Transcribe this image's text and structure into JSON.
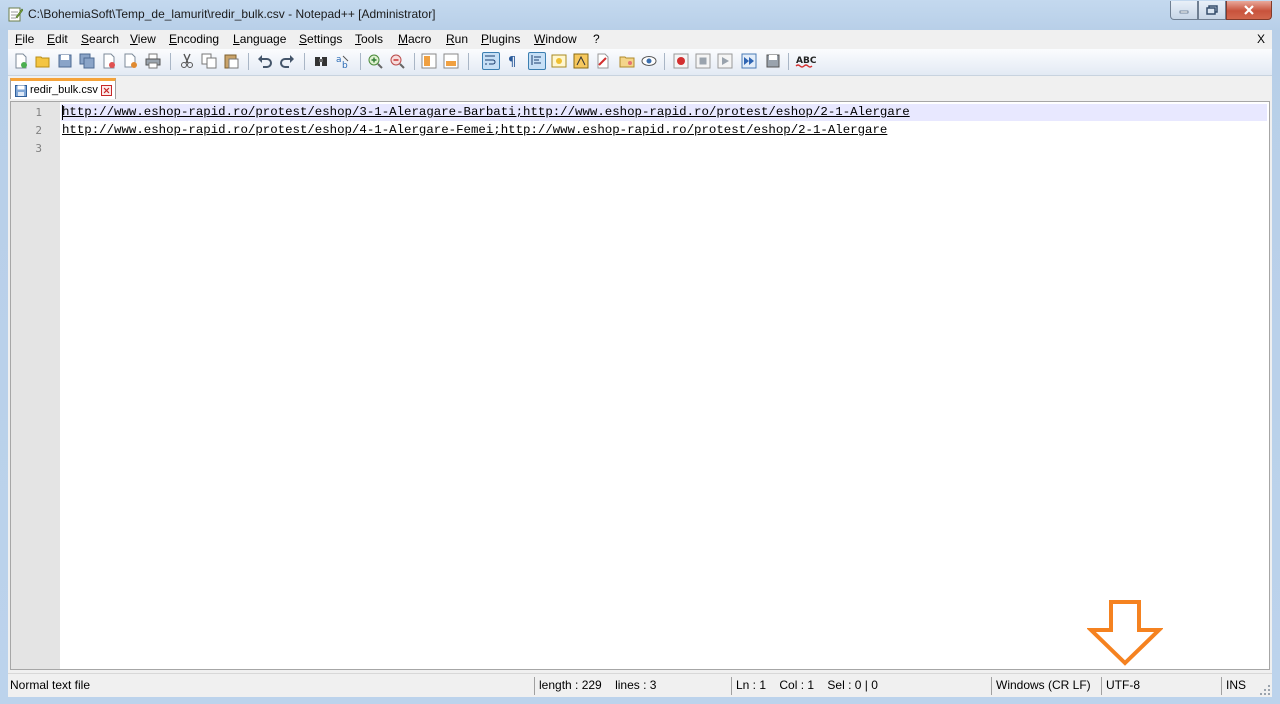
{
  "window": {
    "title": "C:\\BohemiaSoft\\Temp_de_lamurit\\redir_bulk.csv - Notepad++ [Administrator]"
  },
  "menu": {
    "items": [
      "File",
      "Edit",
      "Search",
      "View",
      "Encoding",
      "Language",
      "Settings",
      "Tools",
      "Macro",
      "Run",
      "Plugins",
      "Window",
      "?"
    ],
    "close_label": "X"
  },
  "toolbar": {
    "buttons": [
      "new-file-icon",
      "open-file-icon",
      "save-icon",
      "save-all-icon",
      "close-icon",
      "close-all-icon",
      "print-icon",
      "cut-icon",
      "copy-icon",
      "paste-icon",
      "undo-icon",
      "redo-icon",
      "find-icon",
      "replace-icon",
      "zoom-in-icon",
      "zoom-out-icon",
      "sync-vertical-icon",
      "sync-horizontal-icon",
      "word-wrap-icon",
      "show-all-chars-icon",
      "indent-guide-icon",
      "user-defined-language-icon",
      "function-list-icon",
      "doc-map-icon",
      "folder-workspace-icon",
      "monitor-icon",
      "record-macro-icon",
      "stop-macro-icon",
      "play-macro-icon",
      "run-macro-multiple-icon",
      "save-macro-icon",
      "spell-check-icon"
    ],
    "spell_label": "ABC"
  },
  "tab": {
    "label": "redir_bulk.csv"
  },
  "editor": {
    "line_numbers": [
      "1",
      "2",
      "3"
    ],
    "lines": [
      "http://www.eshop-rapid.ro/protest/eshop/3-1-Aleragare-Barbati;http://www.eshop-rapid.ro/protest/eshop/2-1-Alergare",
      "http://www.eshop-rapid.ro/protest/eshop/4-1-Alergare-Femei;http://www.eshop-rapid.ro/protest/eshop/2-1-Alergare",
      ""
    ]
  },
  "statusbar": {
    "file_type": "Normal text file",
    "length": "length : 229",
    "lines": "lines : 3",
    "ln": "Ln : 1",
    "col": "Col : 1",
    "sel": "Sel : 0 | 0",
    "eol": "Windows (CR LF)",
    "encoding": "UTF-8",
    "mode": "INS"
  },
  "colors": {
    "tab_accent": "#f5a33a",
    "annotation_arrow": "#f58220",
    "current_line": "#e8e8ff"
  }
}
